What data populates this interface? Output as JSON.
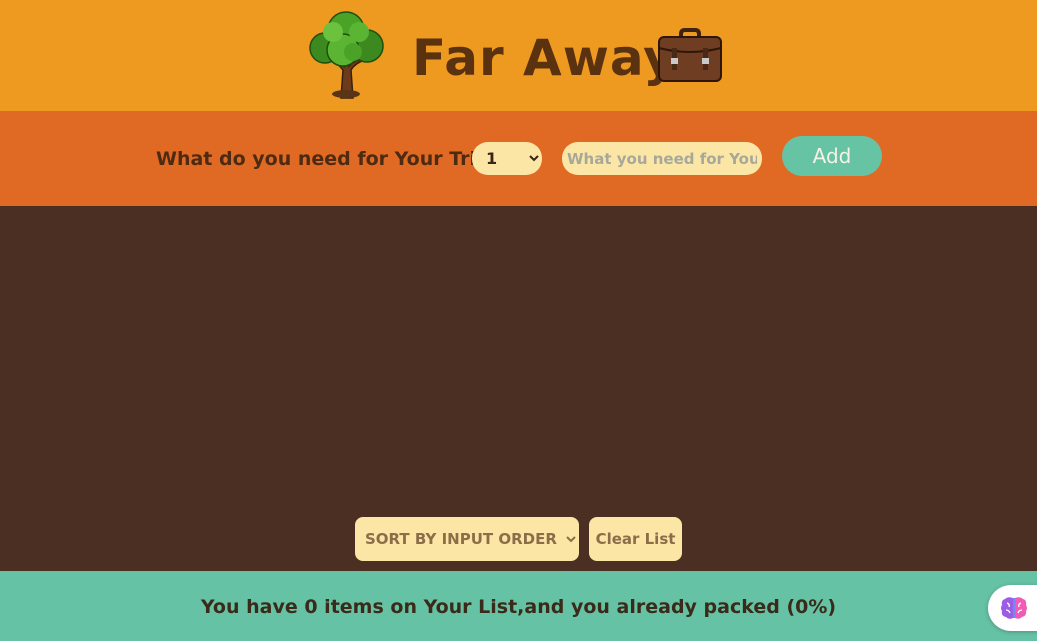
{
  "header": {
    "title": "Far Away",
    "left_icon": "tree-icon",
    "right_icon": "briefcase-icon"
  },
  "form": {
    "label": "What do you need for Your Trip",
    "quantity_value": "1",
    "item_placeholder": "What you need for Your Trip",
    "add_label": "Add"
  },
  "actions": {
    "sort_value": "SORT BY INPUT ORDER",
    "clear_label": "Clear List"
  },
  "stats": {
    "text": "You have 0 items on Your List,and you already packed (0%)"
  },
  "assistant": {
    "icon": "brain-icon"
  },
  "colors": {
    "header_bg": "#ee9a21",
    "form_bg": "#e06a24",
    "list_bg": "#4a2f22",
    "footer_bg": "#66c2a4",
    "input_bg": "#fbe6a5",
    "button_accent": "#66c3a3",
    "title_color": "#5b3210"
  }
}
